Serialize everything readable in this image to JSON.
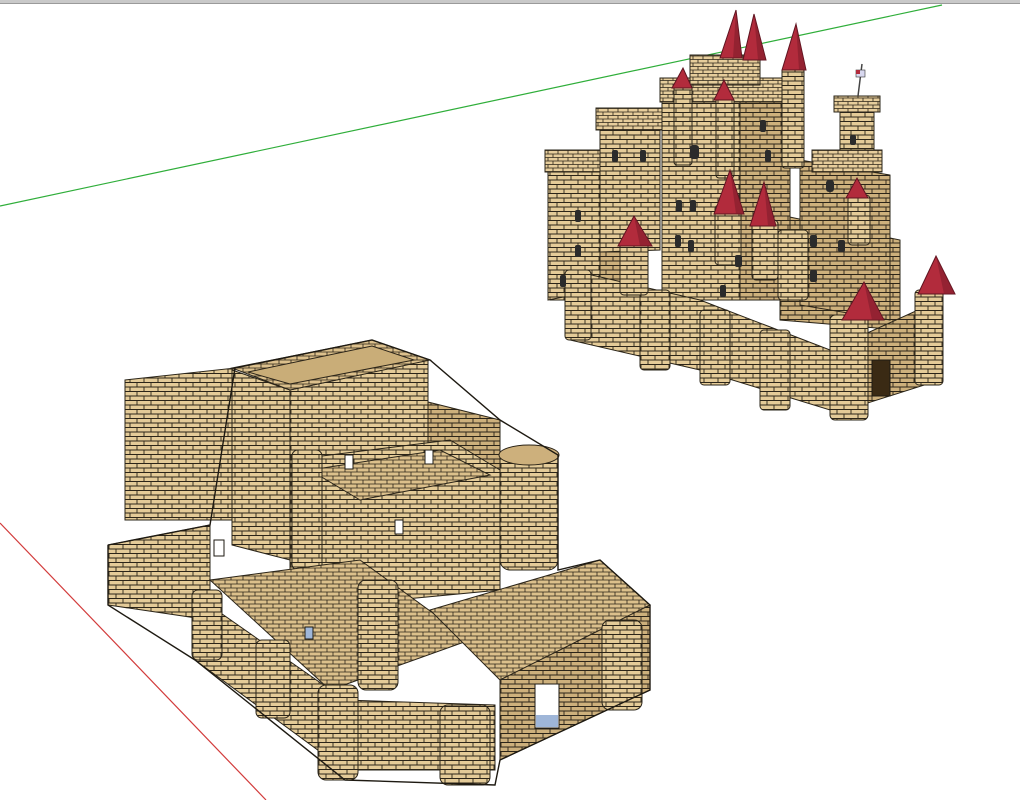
{
  "colors": {
    "background": "#ffffff",
    "stone_light": "#e7cfa0",
    "stone_mid": "#d8bb85",
    "stone_dark": "#b99a66",
    "roof": "#b22b3c",
    "roof_dark": "#7c1b29",
    "door": "#3a2a14",
    "window": "#2b2b2b",
    "glass": "#9fb6d8",
    "axis_green": "#2fae3a",
    "axis_red": "#d23b3b"
  },
  "icons": {
    "flag": "flag-icon"
  }
}
